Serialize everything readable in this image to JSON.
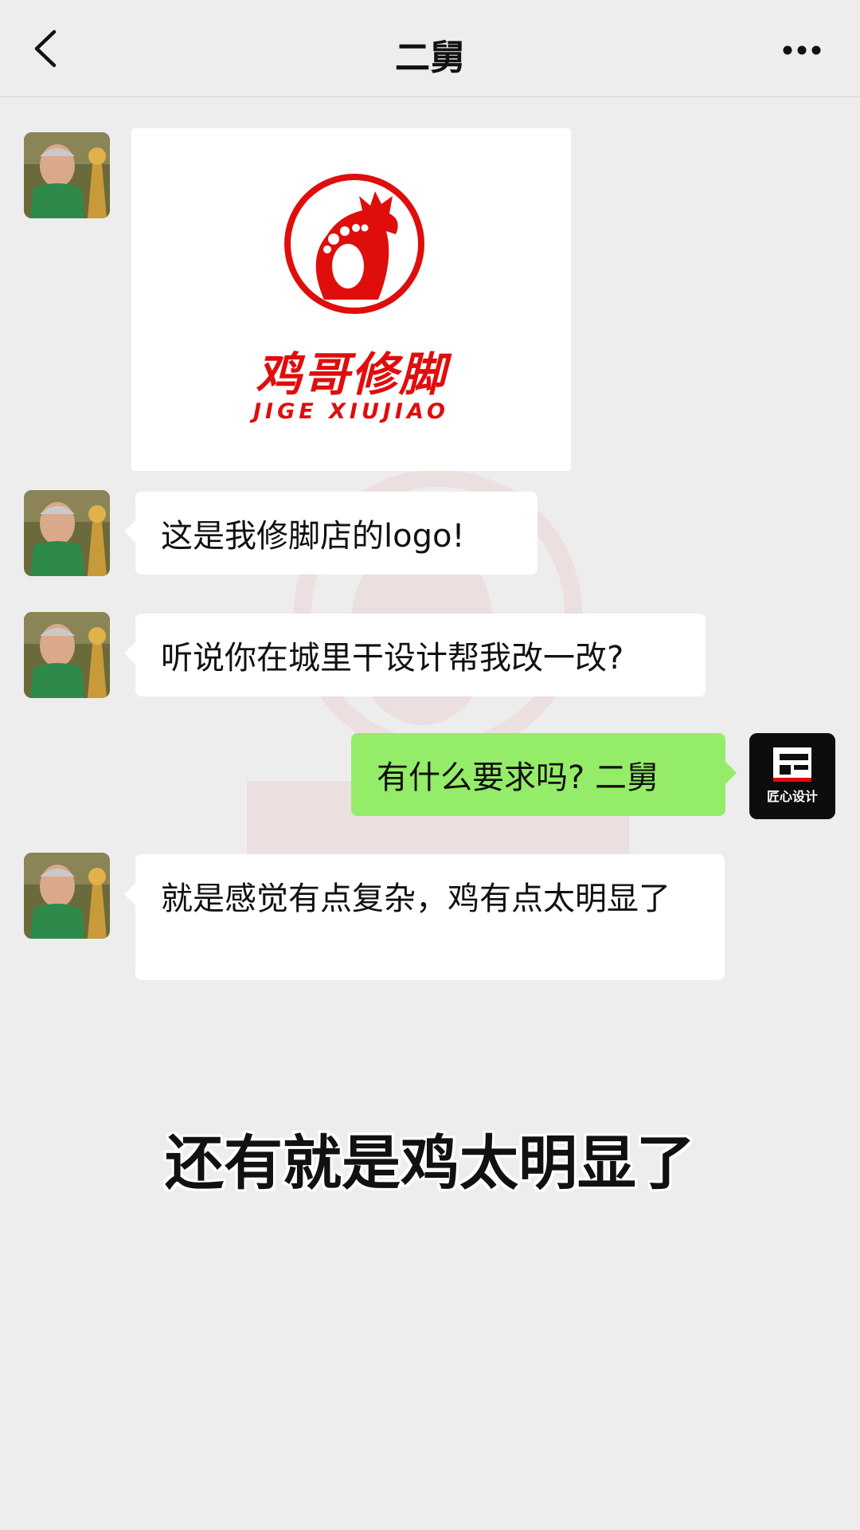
{
  "header": {
    "title": "二舅"
  },
  "messages": [
    {
      "side": "left",
      "type": "image",
      "image": {
        "logo_cn": "鸡哥修脚",
        "logo_en": "JIGE XIUJIAO"
      }
    },
    {
      "side": "left",
      "type": "text",
      "text": "这是我修脚店的logo!"
    },
    {
      "side": "left",
      "type": "text",
      "text": "听说你在城里干设计帮我改一改?"
    },
    {
      "side": "right",
      "type": "text",
      "text": "有什么要求吗? 二舅"
    },
    {
      "side": "left",
      "type": "text",
      "text": "就是感觉有点复杂，鸡有点太明显了"
    }
  ],
  "my_avatar": {
    "label": "匠心设计"
  },
  "caption": "还有就是鸡太明显了",
  "colors": {
    "background": "#ededed",
    "bubble_mine": "#95ec69",
    "bubble_other": "#ffffff",
    "logo_red": "#e00d0d"
  }
}
